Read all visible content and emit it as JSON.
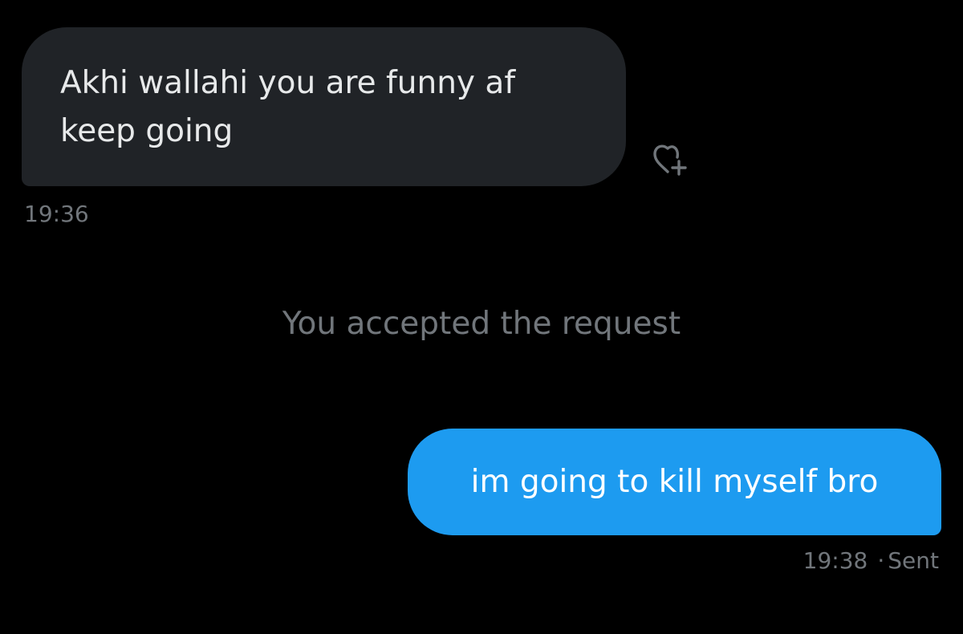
{
  "conversation": {
    "incoming": {
      "lines": [
        "Akhi wallahi you are funny af",
        "keep going"
      ],
      "time": "19:36",
      "react_icon": "heart-plus-icon"
    },
    "system_message": "You accepted the request",
    "outgoing": {
      "text": "im going to kill myself bro",
      "time": "19:38",
      "separator": "·",
      "status": "Sent"
    }
  },
  "colors": {
    "background": "#000000",
    "incoming_bubble": "#202327",
    "outgoing_bubble": "#1d9bf0",
    "secondary_text": "#71767b",
    "primary_text": "#e7e9ea"
  }
}
